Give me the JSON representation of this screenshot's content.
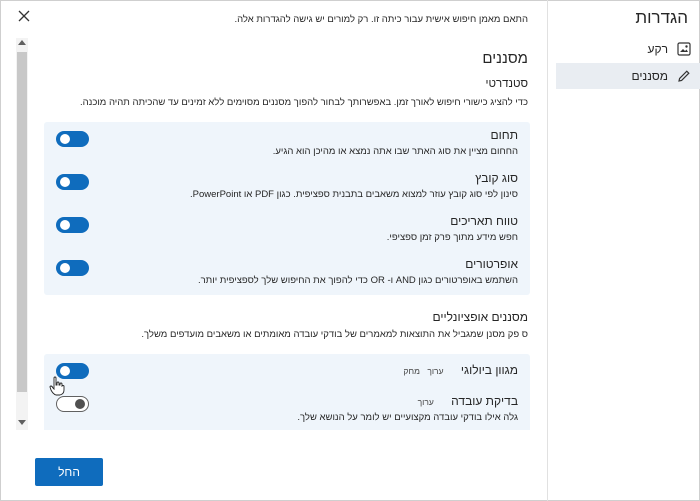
{
  "panel": {
    "title": "הגדרות",
    "items": [
      {
        "label": "רקע",
        "icon": "image-icon"
      },
      {
        "label": "מסננים",
        "icon": "pencil-icon"
      }
    ]
  },
  "header_note": "התאם מאמן חיפוש אישית עבור כיתה זו. רק למורים יש גישה להגדרות אלה.",
  "filters": {
    "title": "מסננים",
    "standard_label": "סטנדרטי",
    "standard_desc": "כדי להציג כישורי חיפוש לאורך זמן. באפשרותך לבחור להפוך מסננים מסוימים ללא זמינים עד שהכיתה תהיה מוכנה.",
    "rows": [
      {
        "title": "תחום",
        "desc": "החחום מציין את סוג האתר שבו אתה נמצא או מהיכן הוא הגיע.",
        "on": true
      },
      {
        "title": "סוג קובץ",
        "desc": "סינון לפי סוג קובץ עוזר למצוא משאבים בתבנית ספציפית. כגון PDF או PowerPoint.",
        "on": true
      },
      {
        "title": "טווח תאריכים",
        "desc": "חפש מידע מתוך פרק זמן ספציפי.",
        "on": true
      },
      {
        "title": "אופרטורים",
        "desc": "השתמש באופרטורים כגון AND ו- OR כדי להפוך את החיפוש שלך לספציפית יותר.",
        "on": true
      }
    ]
  },
  "optional": {
    "title": "מסננים אופציונליים",
    "desc": "ס פק מסנן שמגביל את התוצאות למאמרים של בודקי עובדה מאומתים או משאבים מועדפים משלך.",
    "rows": [
      {
        "title": "מגוון ביולוגי",
        "badges": [
          "ערוך",
          "מחק"
        ],
        "on": true
      },
      {
        "title": "בדיקת עובדה",
        "badges": [
          "ערוך"
        ],
        "desc": "גלה אילו בודקי עובדה מקצועיים יש לומר על הנושא שלך.",
        "on": false
      }
    ]
  },
  "footer": {
    "close_label": "החל"
  },
  "colors": {
    "accent": "#0f6cbd",
    "card_bg": "#eff5fb",
    "active_item_bg": "#e9edf2"
  }
}
